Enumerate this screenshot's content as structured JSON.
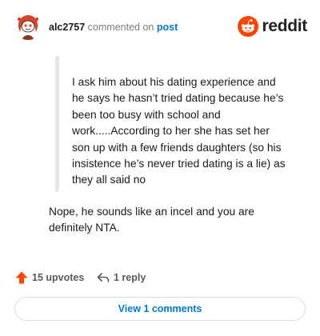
{
  "header": {
    "username": "alc2757",
    "action_text": "commented on",
    "post_link": "post",
    "brand": "reddit",
    "avatar_icon": "snoo-avatar-icon",
    "brand_icon": "reddit-logo-icon"
  },
  "comment": {
    "quote": "I ask him about his dating experience and he says he hasn’t tried dating because he’s been too busy with school and work.....According to her she has set her son up with a few friends daughters (so his insistence he’s never tried dating is a lie) as they all said no",
    "body": "Nope, he sounds like an incel and you are definitely NTA."
  },
  "actions": {
    "upvotes": "15 upvotes",
    "reply": "1 reply",
    "upvote_icon": "upvote-arrow-icon",
    "reply_icon": "reply-arrow-icon"
  },
  "footer": {
    "view_comments": "View 1 comments"
  },
  "colors": {
    "accent": "#0079d3",
    "upvote": "#ff4500",
    "brand": "#ff4500"
  }
}
